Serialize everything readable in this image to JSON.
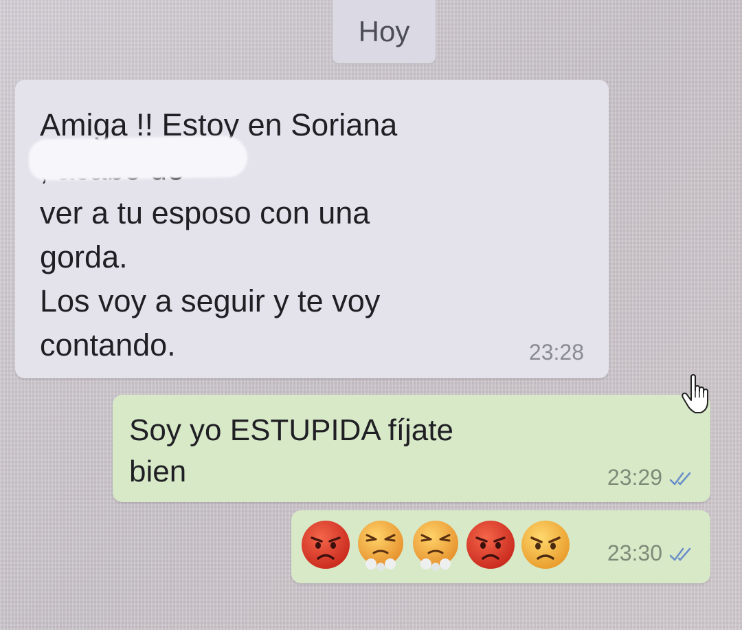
{
  "date_separator": "Hoy",
  "messages": [
    {
      "direction": "incoming",
      "text": "Amiga !! Estoy en Soriana\n          ; acabo de\nver a tu esposo con una\ngorda.\nLos voy a seguir y te voy\ncontando.",
      "time": "23:28",
      "redacted": true
    },
    {
      "direction": "outgoing",
      "text": "Soy yo ESTUPIDA fíjate\nbien",
      "time": "23:29",
      "status": "delivered"
    },
    {
      "direction": "outgoing",
      "emojis": [
        "pouting-face",
        "face-with-steam",
        "face-with-steam",
        "pouting-face",
        "angry-face"
      ],
      "time": "23:30",
      "status": "delivered"
    }
  ],
  "colors": {
    "incoming_bubble": "#e4e3ec",
    "outgoing_bubble": "#d8e9c8",
    "tick_blue": "#6a8fc9",
    "emoji_red": "#d83a2a",
    "emoji_orange": "#f0a13a"
  }
}
